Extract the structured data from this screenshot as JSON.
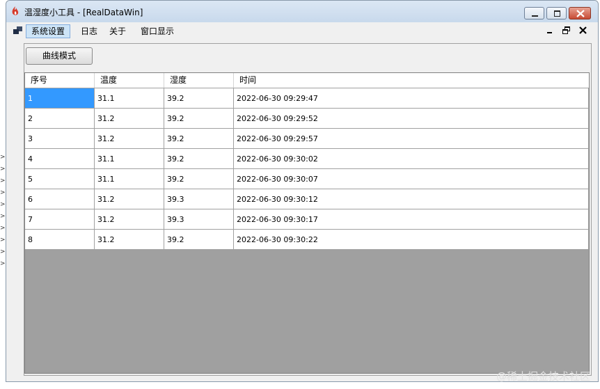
{
  "window": {
    "title": "温湿度小工具 - [RealDataWin]",
    "caption_buttons": {
      "minimize": "minimize-icon",
      "maximize": "maximize-icon",
      "close": "close-icon"
    }
  },
  "menubar": {
    "items": [
      {
        "label": "系统设置",
        "active": true
      },
      {
        "label": "日志",
        "active": false
      },
      {
        "label": "关于",
        "active": false
      },
      {
        "label": "窗口显示",
        "active": false
      }
    ]
  },
  "toolbar": {
    "curve_mode_label": "曲线模式"
  },
  "grid": {
    "columns": [
      "序号",
      "温度",
      "湿度",
      "时间"
    ],
    "rows": [
      [
        "1",
        "31.1",
        "39.2",
        "2022-06-30 09:29:47"
      ],
      [
        "2",
        "31.2",
        "39.2",
        "2022-06-30 09:29:52"
      ],
      [
        "3",
        "31.2",
        "39.2",
        "2022-06-30 09:29:57"
      ],
      [
        "4",
        "31.1",
        "39.2",
        "2022-06-30 09:30:02"
      ],
      [
        "5",
        "31.1",
        "39.2",
        "2022-06-30 09:30:07"
      ],
      [
        "6",
        "31.2",
        "39.3",
        "2022-06-30 09:30:12"
      ],
      [
        "7",
        "31.2",
        "39.3",
        "2022-06-30 09:30:17"
      ],
      [
        "8",
        "31.2",
        "39.2",
        "2022-06-30 09:30:22"
      ]
    ],
    "selected_cell": "1"
  },
  "left_strip": [
    ">",
    ">",
    ">",
    ">",
    ">",
    ">",
    ">",
    ">",
    ">",
    ">"
  ],
  "watermark": "@稀土掘金技术社区",
  "colors": {
    "selection": "#3399ff",
    "grid_background": "#a0a0a0",
    "menu_active": "#cde4f7"
  }
}
